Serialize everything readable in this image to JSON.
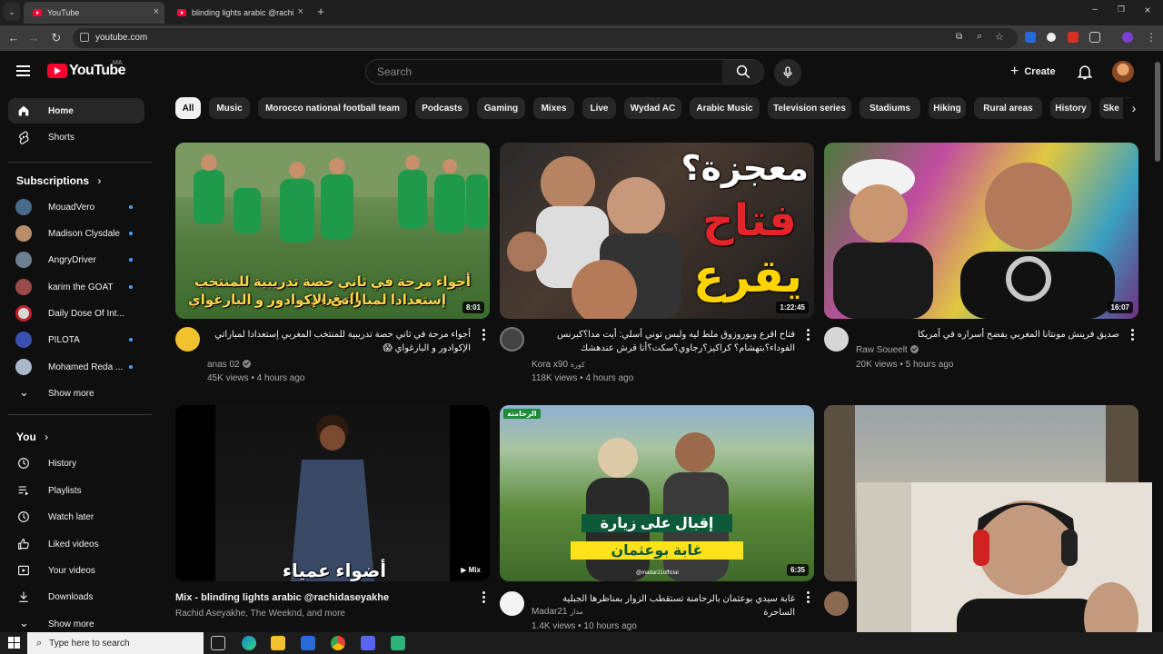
{
  "browser": {
    "tabs": [
      {
        "title": "YouTube",
        "active": true
      },
      {
        "title": "blinding lights arabic @rachida",
        "active": false
      }
    ],
    "new_tab": "+",
    "url": "youtube.com"
  },
  "header": {
    "logo_text": "YouTube",
    "country": "MA",
    "search_placeholder": "Search",
    "create_label": "Create"
  },
  "sidebar": {
    "main": [
      {
        "label": "Home",
        "icon": "home-icon",
        "active": true
      },
      {
        "label": "Shorts",
        "icon": "shorts-icon",
        "active": false
      }
    ],
    "subscriptions_title": "Subscriptions",
    "subscriptions": [
      {
        "label": "MouadVero",
        "color": "#4a6a8a"
      },
      {
        "label": "Madison Clysdale",
        "color": "#b98e6a"
      },
      {
        "label": "AngryDriver",
        "color": "#6e7f92"
      },
      {
        "label": "karim the GOAT",
        "color": "#9a4a4a"
      },
      {
        "label": "Daily Dose Of Int...",
        "color": "#d8d8d8"
      },
      {
        "label": "PILOTA",
        "color": "#3b4fb0"
      },
      {
        "label": "Mohamed Reda ...",
        "color": "#a9b8c8"
      }
    ],
    "show_more_1": "Show more",
    "you_title": "You",
    "you_items": [
      {
        "label": "History",
        "icon": "history-icon"
      },
      {
        "label": "Playlists",
        "icon": "playlists-icon"
      },
      {
        "label": "Watch later",
        "icon": "watch-later-icon"
      },
      {
        "label": "Liked videos",
        "icon": "liked-icon"
      },
      {
        "label": "Your videos",
        "icon": "your-videos-icon"
      },
      {
        "label": "Downloads",
        "icon": "downloads-icon"
      }
    ],
    "show_more_2": "Show more"
  },
  "chips": [
    "All",
    "Music",
    "Morocco national football team",
    "Podcasts",
    "Gaming",
    "Mixes",
    "Live",
    "Wydad AC",
    "Arabic Music",
    "Television series",
    "Stadiums",
    "Hiking",
    "Rural areas",
    "History",
    "Ske"
  ],
  "videos": [
    {
      "title": "أجواء مرحة في ثاني حصة تدريبية للمنتخب المغربي إستعدادا لمباراتي الإكوادور و البارغواي 😱",
      "channel": "anas 02",
      "verified": true,
      "meta": "45K views • 4 hours ago",
      "duration": "8:01",
      "overlay_1": "أجواء مرحة في ثاني حصة تدريبية للمنتخب المغربي",
      "overlay_2": "إستعدادا لمباراتي الإكوادور و البارغواي"
    },
    {
      "title": "فتاح اقرع وبوروزوق ملط ليه ولبس توني أسلي: أيت مدا؟كبرنس الفوداء؟بتهشام؟ كراكيز؟رجاوي؟سكت؟أنا قرش عندهشك",
      "channel": "Kora x90",
      "channel_suffix": "كورة",
      "meta": "118K views • 4 hours ago",
      "duration": "1:22:45",
      "overlay_1": "معجزة؟",
      "overlay_2": "فتاح",
      "overlay_3": "يقرع"
    },
    {
      "title": "صديق فرينش مونتانا المغربي يفضح أسراره في أمريكا",
      "channel": "Raw Soueelt",
      "verified": true,
      "meta": "20K views • 5 hours ago",
      "duration": "16:07"
    },
    {
      "title": "Mix - blinding lights arabic @rachidaseyakhe",
      "channel": "Rachid Aseyakhe, The Weeknd, and more",
      "meta": "",
      "duration": "Mix",
      "overlay_1": "أضواء عمياء"
    },
    {
      "title": "غابة سيدي بوعثمان بالرحامنة تستقطب الزوار بمناظرها الجبلية الساحرة",
      "channel": "Madar21",
      "channel_suffix": "مدار",
      "meta": "1.4K views • 10 hours ago",
      "duration": "6:35",
      "overlay_1": "إقبال على زيارة",
      "overlay_2": "غابة بوعثمان",
      "location": "الرحامنة",
      "handle": "@madar21official"
    },
    {
      "title": "",
      "channel": "",
      "meta": "",
      "duration": ""
    }
  ],
  "taskbar": {
    "search_placeholder": "Type here to search"
  },
  "colors": {
    "background": "#0f0f0f",
    "accent_red": "#ff0033",
    "chip_bg": "#272727",
    "chip_selected_bg": "#f1f1f1",
    "subscription_dot": "#3ea6ff"
  }
}
